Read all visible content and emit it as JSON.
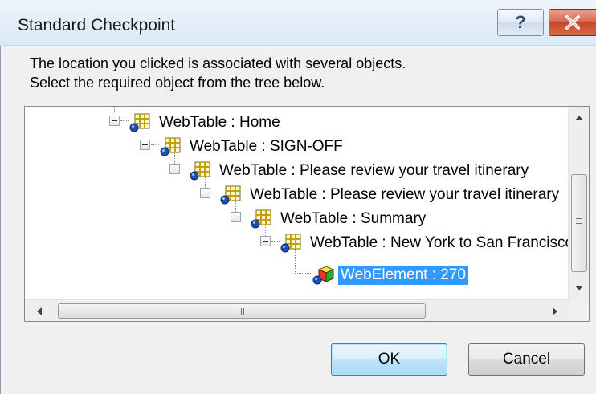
{
  "window": {
    "title": "Standard Checkpoint",
    "help_label": "?"
  },
  "message": {
    "line1": "The location you clicked is associated with several objects.",
    "line2": "Select the required object from the tree below."
  },
  "tree": {
    "nodes": [
      {
        "label": "WebTable : Home",
        "icon": "webtable-icon",
        "expanded": true,
        "selected": false
      },
      {
        "label": "WebTable : SIGN-OFF",
        "icon": "webtable-icon",
        "expanded": true,
        "selected": false
      },
      {
        "label": "WebTable : Please review your travel itinerary",
        "icon": "webtable-icon",
        "expanded": true,
        "selected": false
      },
      {
        "label": "WebTable : Please review your travel itinerary",
        "icon": "webtable-icon",
        "expanded": true,
        "selected": false
      },
      {
        "label": "WebTable : Summary",
        "icon": "webtable-icon",
        "expanded": true,
        "selected": false
      },
      {
        "label": "WebTable : New York to San Francisco",
        "icon": "webtable-icon",
        "expanded": true,
        "selected": false
      },
      {
        "label": "WebElement : 270",
        "icon": "webelement-icon",
        "expanded": false,
        "selected": true
      }
    ],
    "hscroll_grip": "III"
  },
  "buttons": {
    "ok_label": "OK",
    "cancel_label": "Cancel"
  },
  "colors": {
    "selection": "#3399ff",
    "close_button": "#c64628",
    "ok_border": "#3c7fb1"
  }
}
